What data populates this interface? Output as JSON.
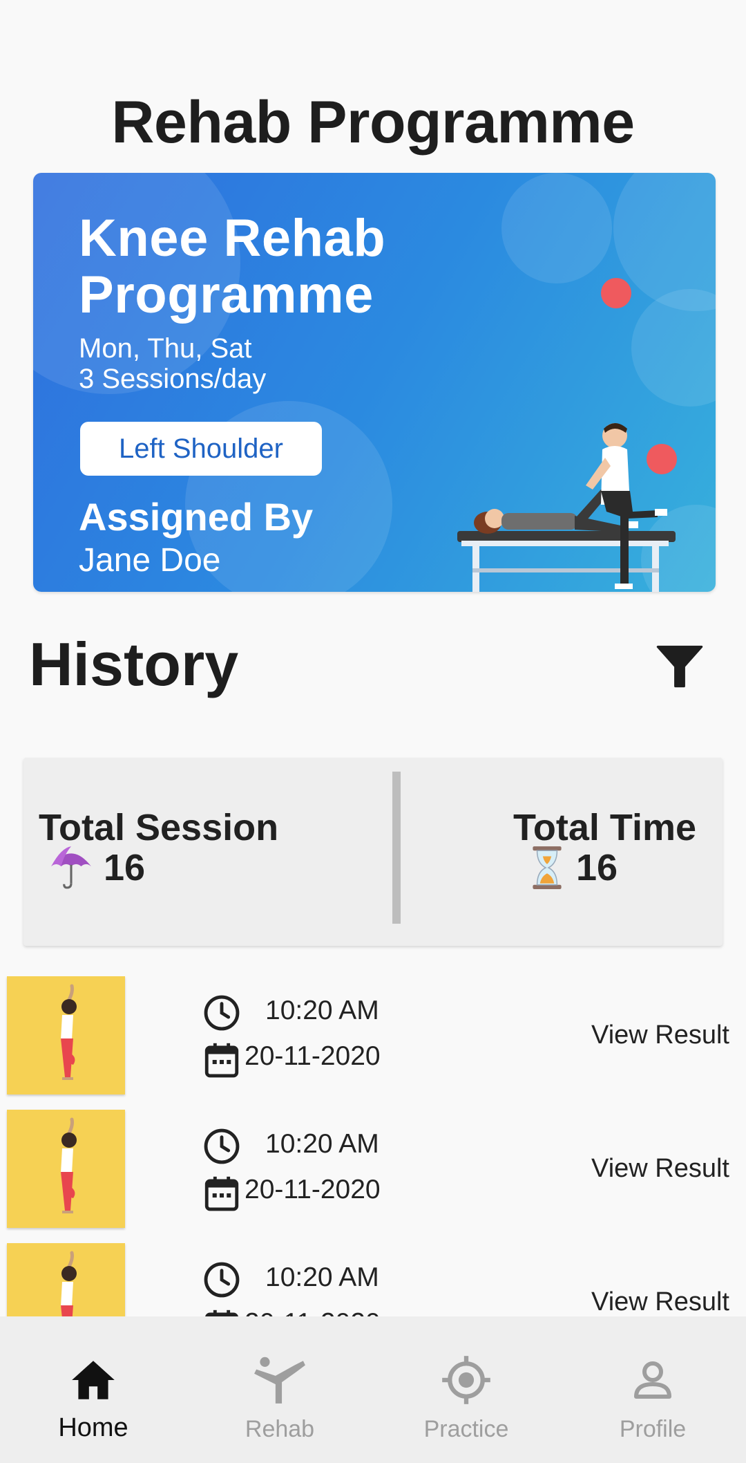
{
  "header": {
    "title": "Rehab Programme"
  },
  "banner": {
    "title_line1": "Knee Rehab",
    "title_line2": "Programme",
    "days": "Mon, Thu, Sat",
    "sessions": "3 Sessions/day",
    "body_part": "Left Shoulder",
    "assigned_label": "Assigned By",
    "assigned_name": "Jane Doe",
    "colors": {
      "gradient_start": "#2f6fde",
      "gradient_end": "#37b0dc",
      "dot": "#ef5a5e"
    }
  },
  "history": {
    "title": "History",
    "filter_icon": "filter-icon",
    "stats": {
      "total_session_label": "Total Session",
      "total_session_value": "16",
      "total_session_icon": "umbrella-icon",
      "total_time_label": "Total Time",
      "total_time_value": "16",
      "total_time_icon": "hourglass-icon"
    },
    "items": [
      {
        "time": "10:20 AM",
        "date": "20-11-2020",
        "action": "View Result"
      },
      {
        "time": "10:20 AM",
        "date": "20-11-2020",
        "action": "View Result"
      },
      {
        "time": "10:20 AM",
        "date": "20-11-2020",
        "action": "View Result"
      }
    ]
  },
  "nav": {
    "items": [
      {
        "label": "Home",
        "icon": "home-icon",
        "active": true
      },
      {
        "label": "Rehab",
        "icon": "martial-arts-icon",
        "active": false
      },
      {
        "label": "Practice",
        "icon": "target-icon",
        "active": false
      },
      {
        "label": "Profile",
        "icon": "person-icon",
        "active": false
      }
    ]
  }
}
